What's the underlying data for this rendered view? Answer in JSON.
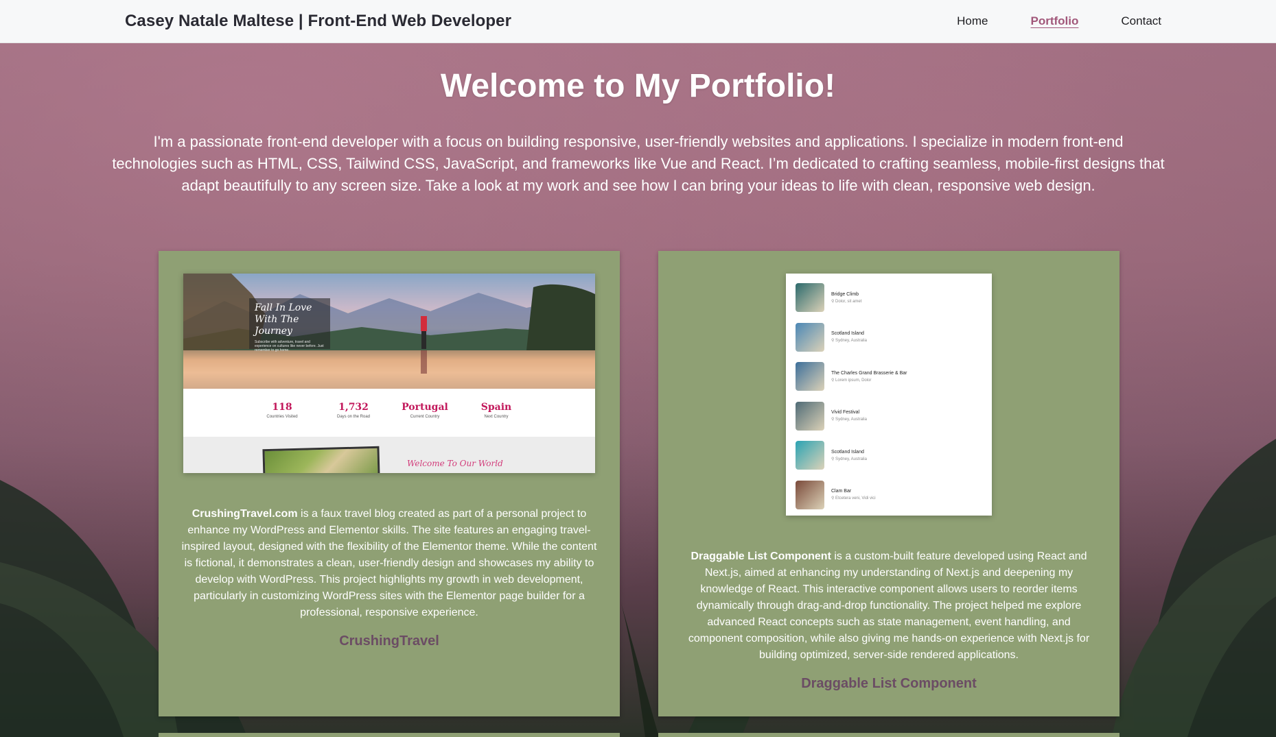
{
  "header": {
    "brand": "Casey Natale Maltese | Front-End Web Developer",
    "nav": [
      {
        "label": "Home",
        "active": false
      },
      {
        "label": "Portfolio",
        "active": true
      },
      {
        "label": "Contact",
        "active": false
      }
    ]
  },
  "hero": {
    "title": "Welcome to My Portfolio!",
    "text": "I'm a passionate front-end developer with a focus on building responsive, user-friendly websites and applications. I specialize in modern front-end technologies such as HTML, CSS, Tailwind CSS, JavaScript, and frameworks like Vue and React. I’m dedicated to crafting seamless, mobile-first designs that adapt beautifully to any screen size. Take a look at my work and see how I can bring your ideas to life with clean, responsive web design."
  },
  "projects": [
    {
      "desc_bold": "CrushingTravel.com",
      "desc_rest": " is a faux travel blog created as part of a personal project to enhance my WordPress and Elementor skills. The site features an engaging travel-inspired layout, designed with the flexibility of the Elementor theme. While the content is fictional, it demonstrates a clean, user-friendly design and showcases my ability to develop with WordPress. This project highlights my growth in web development, particularly in customizing WordPress sites with the Elementor page builder for a professional, responsive experience.",
      "link_label": "CrushingTravel",
      "preview": {
        "caption_title": "Fall In Love With The Journey",
        "caption_sub": "Subscribe with adventure, travel and experience on cultures like never before. Just remember to go home.",
        "stats": [
          {
            "value": "118",
            "label": "Countries Visited"
          },
          {
            "value": "1,732",
            "label": "Days on the Road"
          },
          {
            "value": "Portugal",
            "label": "Current Country"
          },
          {
            "value": "Spain",
            "label": "Next Country"
          }
        ],
        "welcome": "Welcome To Our World"
      }
    },
    {
      "desc_bold": "Draggable List Component",
      "desc_rest": " is a custom-built feature developed using React and Next.js, aimed at enhancing my understanding of Next.js and deepening my knowledge of React. This interactive component allows users to reorder items dynamically through drag-and-drop functionality. The project helped me explore advanced React concepts such as state management, event handling, and component composition, while also giving me hands-on experience with Next.js for building optimized, server-side rendered applications.",
      "link_label": "Draggable List Component",
      "preview": {
        "items": [
          {
            "name": "Bridge Climb",
            "location": "Dolor, sit amet",
            "color": "#2c6a6c"
          },
          {
            "name": "Scotland Island",
            "location": "Sydney, Australia",
            "color": "#4b87b5"
          },
          {
            "name": "The Charles Grand Brasserie & Bar",
            "location": "Lorem ipsum, Dolor",
            "color": "#3d6f9a"
          },
          {
            "name": "Vivid Festival",
            "location": "Sydney, Australia",
            "color": "#4f6b76"
          },
          {
            "name": "Scotland Island",
            "location": "Sydney, Australia",
            "color": "#2aa3b3"
          },
          {
            "name": "Clam Bar",
            "location": "Etcetera veni, Vidi vici",
            "color": "#7a4a3a"
          }
        ]
      }
    }
  ]
}
